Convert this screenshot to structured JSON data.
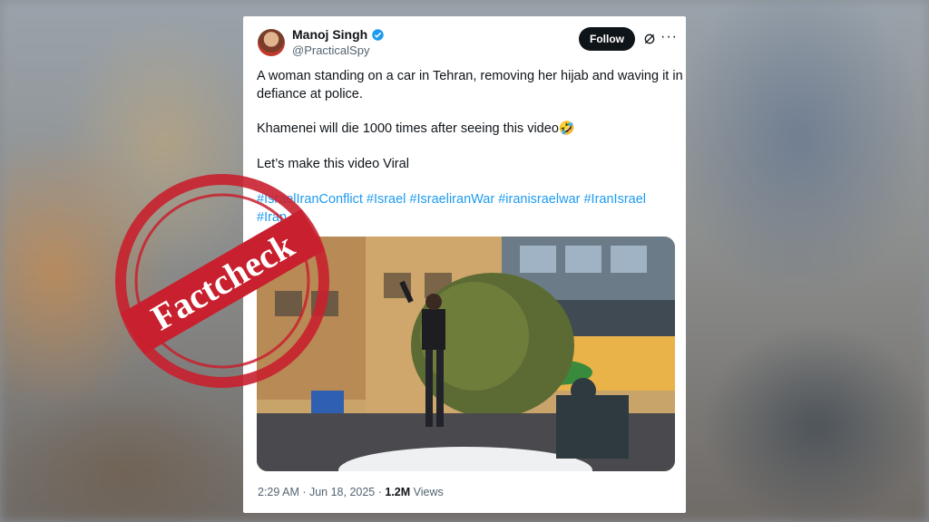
{
  "post": {
    "author_name": "Manoj Singh",
    "handle": "@PracticalSpy",
    "follow_label": "Follow",
    "text_line1": "A woman standing on a car in Tehran, removing her hijab and waving it in",
    "text_line2": "defiance at police.",
    "text_line3": "Khamenei will die 1000 times after seeing this video🤣",
    "text_line4": "Let’s make this video Viral",
    "hashtags_line1": "#IsraelIranConflict #Israel #IsraeliranWar #iranisraelwar #IranIsrael",
    "hashtags_line2": "#Iran",
    "timestamp": "2:29 AM · Jun 18, 2025 · ",
    "views_count": "1.2M",
    "views_label": " Views"
  },
  "stamp": {
    "label": "Factcheck",
    "color": "#c8202e"
  },
  "icons": {
    "verified": "verified-badge-icon",
    "grok": "grok-icon",
    "more": "more-icon"
  },
  "colors": {
    "link": "#1d9bf0",
    "follow_bg": "#0f1419"
  }
}
